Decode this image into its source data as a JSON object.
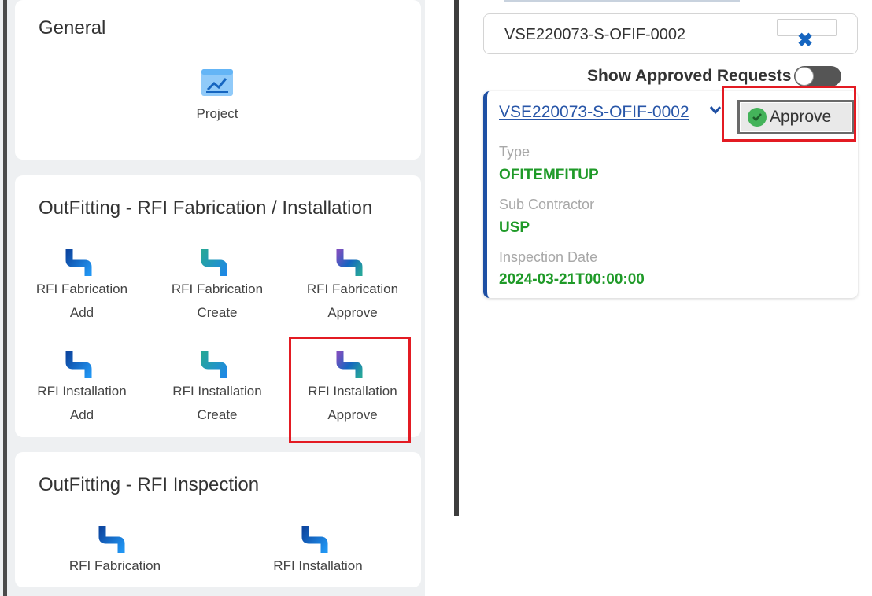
{
  "general": {
    "title": "General",
    "tiles": [
      {
        "label": "Project",
        "icon": "chart-document-icon"
      }
    ]
  },
  "fabrication_installation": {
    "title": "OutFitting - RFI Fabrication / Installation",
    "tiles": [
      {
        "line1": "RFI Fabrication",
        "line2": "Add",
        "icon": "pipe-icon",
        "variant": "blue"
      },
      {
        "line1": "RFI Fabrication",
        "line2": "Create",
        "icon": "pipe-icon",
        "variant": "teal"
      },
      {
        "line1": "RFI Fabrication",
        "line2": "Approve",
        "icon": "pipe-icon",
        "variant": "purple"
      },
      {
        "line1": "RFI Installation",
        "line2": "Add",
        "icon": "pipe-icon",
        "variant": "blue"
      },
      {
        "line1": "RFI Installation",
        "line2": "Create",
        "icon": "pipe-icon",
        "variant": "teal"
      },
      {
        "line1": "RFI Installation",
        "line2": "Approve",
        "icon": "pipe-icon",
        "variant": "purple"
      }
    ]
  },
  "inspection": {
    "title": "OutFitting - RFI Inspection",
    "tiles": [
      {
        "label": "RFI Fabrication",
        "icon": "pipe-icon",
        "variant": "blue"
      },
      {
        "label": "RFI Installation",
        "icon": "pipe-icon",
        "variant": "blue"
      }
    ]
  },
  "search": {
    "value": "VSE220073-S-OFIF-0002",
    "clear_icon": "close-icon"
  },
  "toggle": {
    "label": "Show Approved Requests",
    "state": "off"
  },
  "request": {
    "id": "VSE220073-S-OFIF-0002",
    "approve_label": "Approve",
    "fields": [
      {
        "label": "Type",
        "value": "OFITEMFITUP"
      },
      {
        "label": "Sub Contractor",
        "value": "USP"
      },
      {
        "label": "Inspection Date",
        "value": "2024-03-21T00:00:00"
      }
    ]
  },
  "colors": {
    "highlight": "#e31b23",
    "link": "#2856a8",
    "field_value": "#1f9a28",
    "card_accent": "#1e4fa3",
    "pipe_blue": "#1565c0",
    "pipe_teal": "#26a69a",
    "pipe_purple": "#8e44ad"
  }
}
